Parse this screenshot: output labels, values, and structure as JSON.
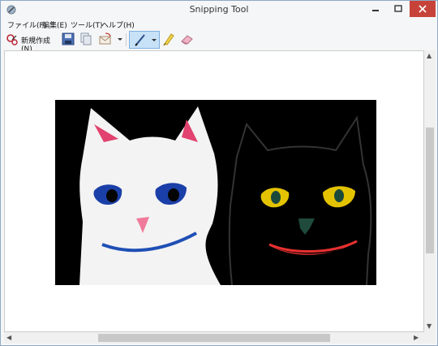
{
  "window": {
    "title": "Snipping Tool"
  },
  "menu": {
    "items": [
      "ファイル(F)",
      "編集(E)",
      "ツール(T)",
      "ヘルプ(H)"
    ]
  },
  "toolbar": {
    "new_label": "新規作成(N)"
  },
  "colors": {
    "accent": "#7fb1df",
    "close_button": "#c7433a",
    "canvas_bg": "#ffffff"
  },
  "icons": [
    "app-icon",
    "new-snip-icon",
    "save-icon",
    "copy-icon",
    "send-email-icon",
    "dropdown-arrow-icon",
    "pen-icon",
    "highlighter-icon",
    "eraser-icon"
  ]
}
